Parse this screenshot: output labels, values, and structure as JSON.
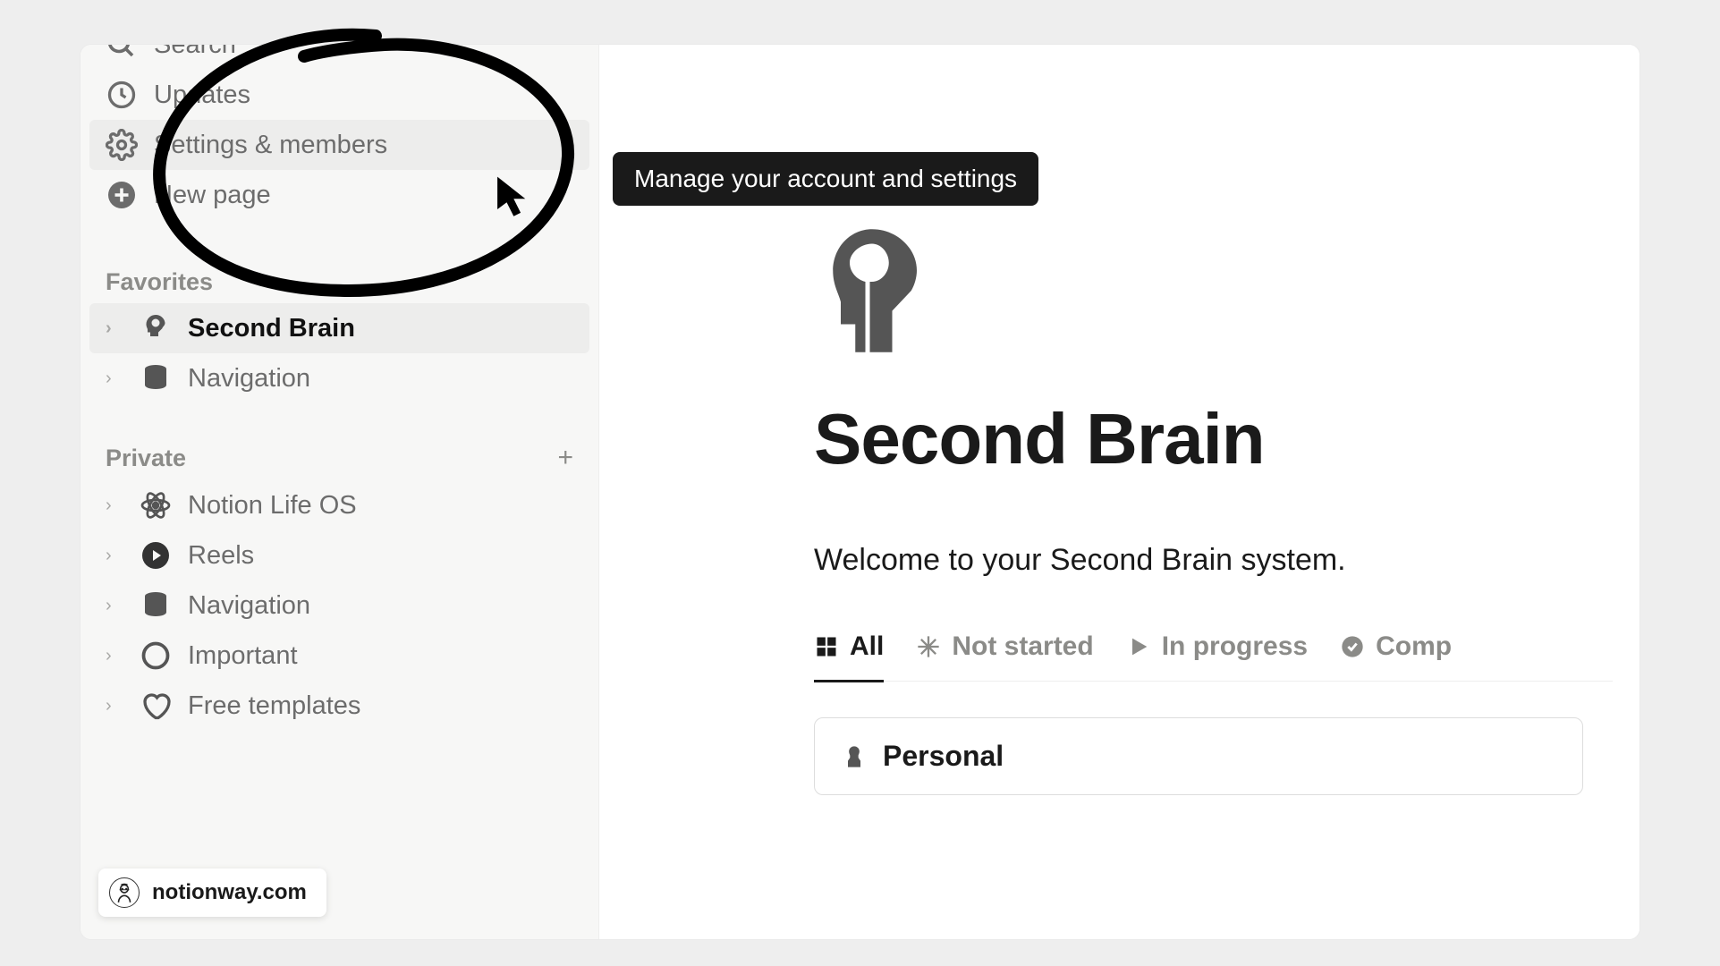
{
  "sidebar": {
    "top_items": [
      {
        "icon": "search",
        "label": "Search"
      },
      {
        "icon": "clock",
        "label": "Updates"
      },
      {
        "icon": "gear",
        "label": "Settings & members",
        "hovered": true
      },
      {
        "icon": "plus-circle",
        "label": "New page"
      }
    ],
    "sections": {
      "favorites": {
        "title": "Favorites",
        "items": [
          {
            "icon": "head",
            "label": "Second Brain",
            "active": true
          },
          {
            "icon": "database",
            "label": "Navigation"
          }
        ]
      },
      "private": {
        "title": "Private",
        "items": [
          {
            "icon": "atom",
            "label": "Notion Life OS"
          },
          {
            "icon": "play-circle",
            "label": "Reels"
          },
          {
            "icon": "database",
            "label": "Navigation"
          },
          {
            "icon": "circle",
            "label": "Important"
          },
          {
            "icon": "heart-outline",
            "label": "Free templates"
          }
        ]
      }
    }
  },
  "tooltip": "Manage your account and settings",
  "page": {
    "title": "Second Brain",
    "subtitle": "Welcome to your Second Brain system.",
    "tabs": [
      {
        "icon": "grid",
        "label": "All",
        "active": true
      },
      {
        "icon": "snowflake",
        "label": "Not started"
      },
      {
        "icon": "play",
        "label": "In progress"
      },
      {
        "icon": "check-circle",
        "label": "Comp"
      }
    ],
    "card": {
      "icon": "person-silhouette",
      "label": "Personal"
    }
  },
  "watermark": "notionway.com"
}
